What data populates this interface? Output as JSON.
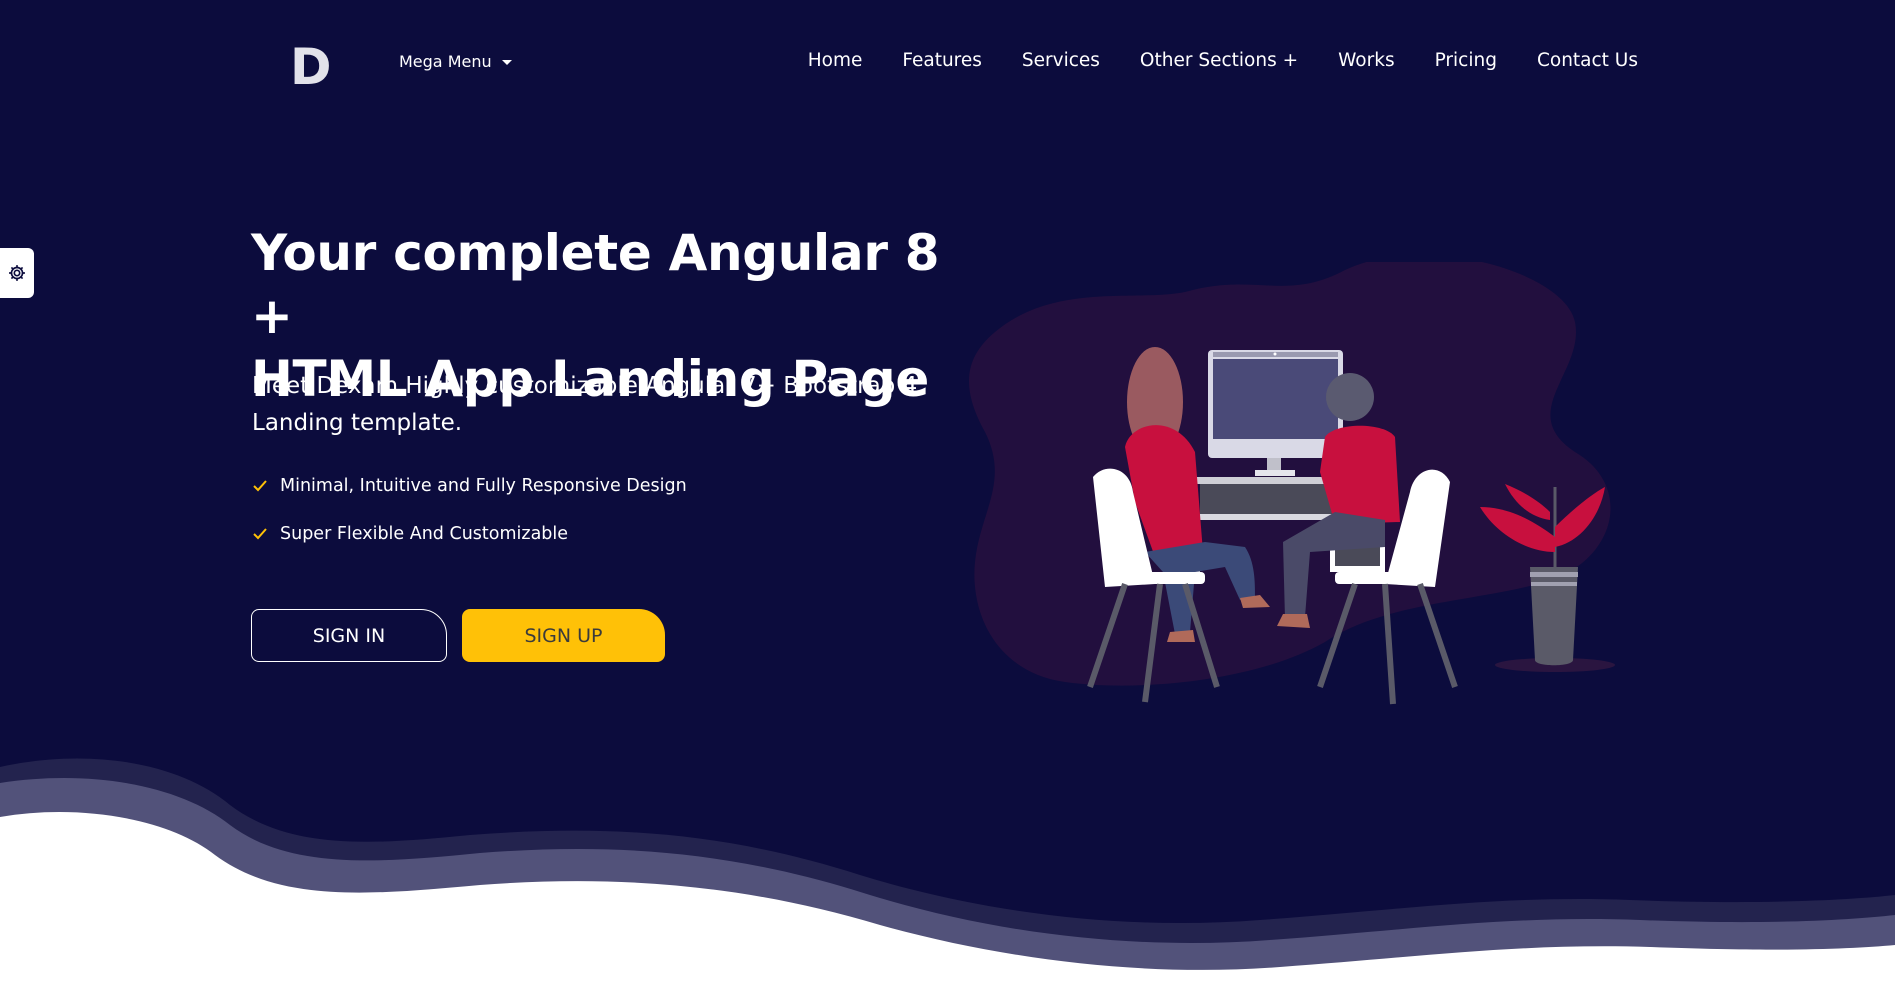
{
  "header": {
    "logo_letter": "D",
    "mega_menu_label": "Mega Menu",
    "nav": [
      "Home",
      "Features",
      "Services",
      "Other Sections +",
      "Works",
      "Pricing",
      "Contact Us"
    ]
  },
  "hero": {
    "title_line1": "Your complete Angular 8 +",
    "title_line2": "HTML App Landing Page",
    "subtitle_line1": "Meet Dexam Highly customizable Angular 7+ Bootstrap 4",
    "subtitle_line2": "Landing template.",
    "features": [
      "Minimal, Intuitive and Fully Responsive Design",
      "Super Flexible And Customizable"
    ],
    "signin_label": "SIGN IN",
    "signup_label": "SIGN UP"
  },
  "icons": {
    "settings": "gear-icon",
    "check": "check-icon",
    "caret": "caret-down-icon"
  },
  "colors": {
    "background": "#0c0c3d",
    "accent": "#ffc107",
    "illustration_red": "#c8103e"
  }
}
